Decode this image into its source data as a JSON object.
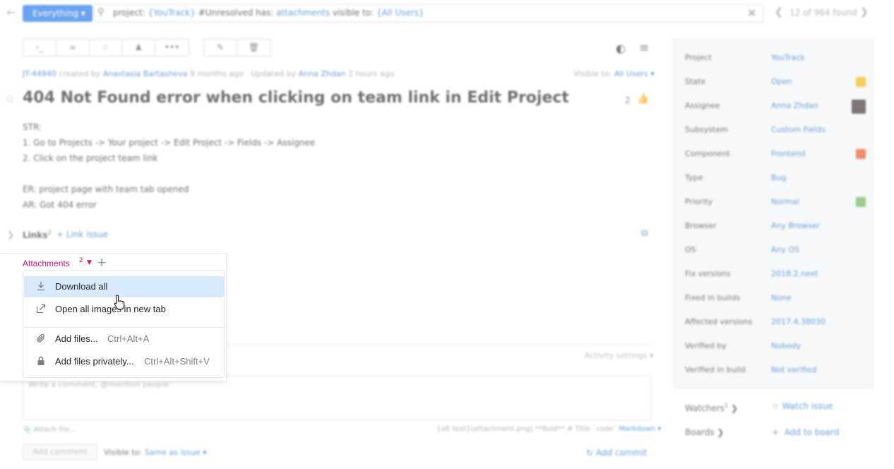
{
  "search": {
    "context": "Everything ▾",
    "query_field1": "project:",
    "query_val1": "{YouTrack}",
    "query_mid": "#Unresolved has:",
    "query_val2": "attachments",
    "query_field3": "visible to:",
    "query_val3": "{All Users}",
    "found": "12 of 964 found"
  },
  "toolbar": {
    "left_icons": [
      "console-icon",
      "link-icon",
      "tag-icon",
      "user-icon",
      "more-icon"
    ],
    "right_icons": [
      "edit-icon",
      "delete-icon"
    ]
  },
  "issue": {
    "id": "JT-44940",
    "created_prefix": "created by",
    "creator": "Anastasia Bartasheva",
    "created_ago": "9 months ago",
    "updated_prefix": "Updated by",
    "updater": "Anna Zhdan",
    "updated_ago": "2 hours ago",
    "visible_prefix": "Visible to:",
    "visible_value": "All Users ▾",
    "title": "404 Not Found error when clicking on team link in Edit Project",
    "votes": "2",
    "description": [
      "STR:",
      "1. Go to Projects -> Your project -> Edit Project -> Fields -> Assignee",
      "2. Click on the project team link",
      "",
      "ER: project page with team tab opened",
      "AR: Got 404 error"
    ],
    "links_label": "Links",
    "links_count": "2",
    "link_issue": "+ Link issue"
  },
  "activity": {
    "settings": "Activity settings ▾",
    "comment_placeholder": "Write a comment, @mention people",
    "attach_file": "Attach file...",
    "markdown_hint": "{alt text}(attachment.png) **Bold** # Title `code`",
    "markdown_link": "Markdown ▾",
    "add_comment": "Add comment",
    "visible_prefix": "Visible to:",
    "visible_value": "Same as issue ▾",
    "add_commit": "Add commit"
  },
  "fields": [
    {
      "label": "Project",
      "value": "YouTrack"
    },
    {
      "label": "State",
      "value": "Open"
    },
    {
      "label": "Assignee",
      "value": "Anna Zhdan"
    },
    {
      "label": "Subsystem",
      "value": "Custom Fields"
    },
    {
      "label": "Component",
      "value": "Frontend"
    },
    {
      "label": "Type",
      "value": "Bug"
    },
    {
      "label": "Priority",
      "value": "Normal"
    },
    {
      "label": "Browser",
      "value": "Any Browser"
    },
    {
      "label": "OS",
      "value": "Any OS"
    },
    {
      "label": "Fix versions",
      "value": "2018.2.next"
    },
    {
      "label": "Fixed in builds",
      "value": "None"
    },
    {
      "label": "Affected versions",
      "value": "2017.4.38030"
    },
    {
      "label": "Verified by",
      "value": "Nobody"
    },
    {
      "label": "Verified in build",
      "value": "Not verified"
    }
  ],
  "field_badges": {
    "state": "#f0b400",
    "component": "#e8521e",
    "priority": "#6ab04c"
  },
  "sidebar": {
    "watchers": "Watchers",
    "watchers_count": "1",
    "watch_issue": "Watch issue",
    "boards": "Boards",
    "add_to_board": "Add to board"
  },
  "attachments": {
    "label": "Attachments",
    "count": "2",
    "menu": [
      {
        "label": "Download all",
        "shortcut": "",
        "icon": "download-icon"
      },
      {
        "label": "Open all images in new tab",
        "shortcut": "",
        "icon": "external-link-icon"
      },
      {
        "label": "Add files...",
        "shortcut": "Ctrl+Alt+A",
        "icon": "paperclip-icon"
      },
      {
        "label": "Add files privately...",
        "shortcut": "Ctrl+Alt+Shift+V",
        "icon": "lock-icon"
      }
    ]
  },
  "colors": {
    "accent": "#1a73e8",
    "link": "#1a6fc7",
    "attachments": "#d20d7a",
    "hover": "#d8eafc"
  }
}
